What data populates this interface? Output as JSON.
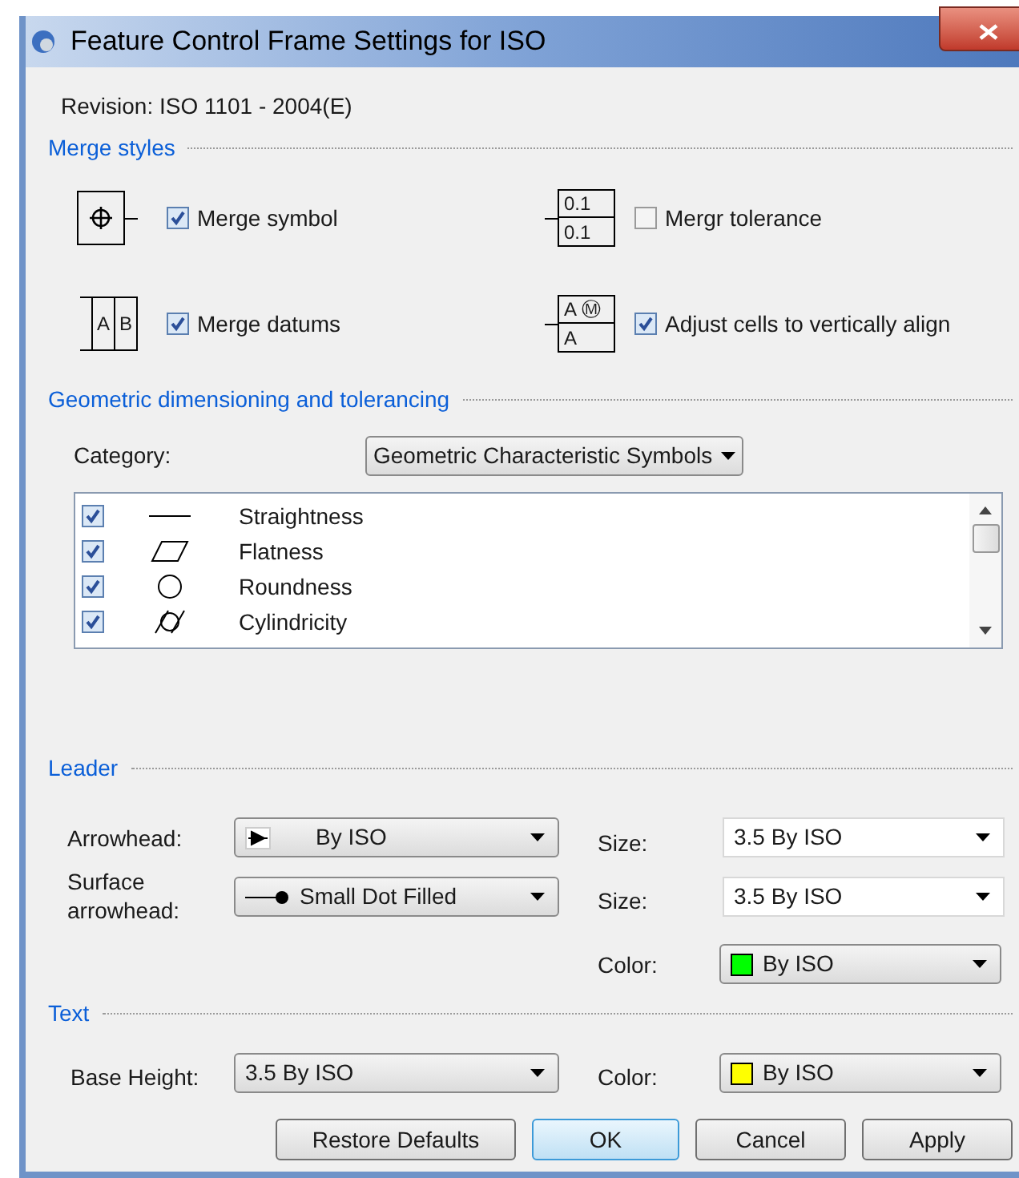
{
  "window": {
    "title": "Feature Control Frame Settings for ISO"
  },
  "revision": "Revision: ISO 1101 - 2004(E)",
  "merge_styles": {
    "heading": "Merge styles",
    "options": [
      {
        "kind": "symbol",
        "label": "Merge symbol",
        "checked": true
      },
      {
        "kind": "stack",
        "label": "Mergr tolerance",
        "checked": false,
        "cells": [
          "0.1",
          "0.1"
        ]
      },
      {
        "kind": "datums",
        "label": "Merge datums",
        "checked": true,
        "cells": [
          "A",
          "B"
        ]
      },
      {
        "kind": "modifier",
        "label": "Adjust cells to vertically align",
        "checked": true,
        "cells": [
          "A",
          "Ⓜ",
          "A"
        ]
      }
    ]
  },
  "gdt": {
    "heading": "Geometric dimensioning and tolerancing",
    "category_label": "Category:",
    "category_value": "Geometric Characteristic Symbols",
    "symbols": [
      {
        "kind": "straightness",
        "label": "Straightness",
        "checked": true
      },
      {
        "kind": "flatness",
        "label": "Flatness",
        "checked": true
      },
      {
        "kind": "roundness",
        "label": "Roundness",
        "checked": true
      },
      {
        "kind": "cylindricity",
        "label": "Cylindricity",
        "checked": true
      }
    ]
  },
  "leader": {
    "heading": "Leader",
    "arrowhead_label": "Arrowhead:",
    "arrowhead_value": "By ISO",
    "size_label": "Size:",
    "size_value": "3.5 By ISO",
    "surface_label": "Surface arrowhead:",
    "surface_value": "Small Dot Filled",
    "surface_size_label": "Size:",
    "surface_size_value": "3.5 By ISO",
    "color_label": "Color:",
    "color_value": "By ISO",
    "color": "#00ff00"
  },
  "text": {
    "heading": "Text",
    "base_height_label": "Base Height:",
    "base_height_value": "3.5 By ISO",
    "color_label": "Color:",
    "color_value": "By ISO",
    "color": "#ffff00"
  },
  "buttons": [
    {
      "label": "Restore Defaults",
      "default": false
    },
    {
      "label": "OK",
      "default": true
    },
    {
      "label": "Cancel",
      "default": false
    },
    {
      "label": "Apply",
      "default": false
    }
  ]
}
